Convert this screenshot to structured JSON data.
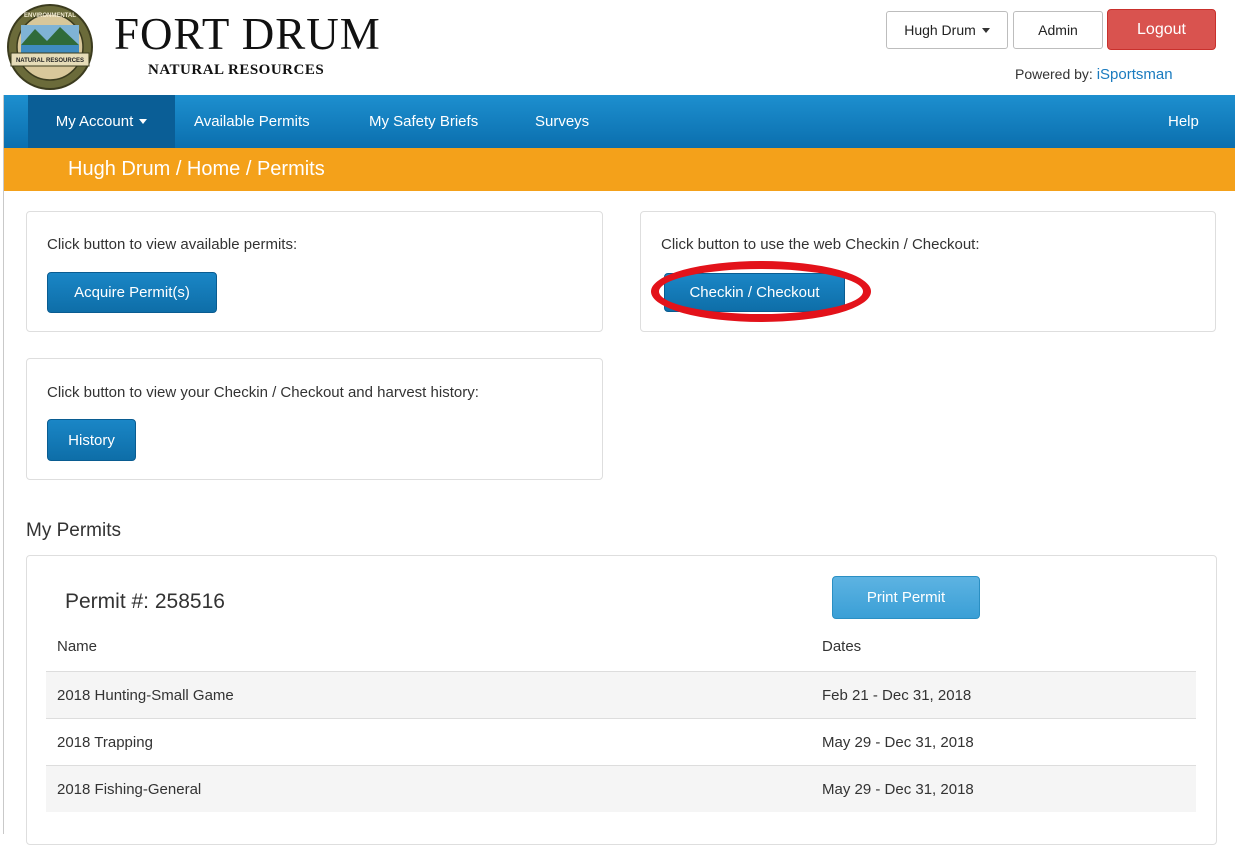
{
  "header": {
    "logo_text": [
      "ENVIRONMENTAL",
      "NATURAL RESOURCES"
    ],
    "brand_title": "FORT DRUM",
    "brand_subtitle": "NATURAL RESOURCES",
    "user_menu_label": "Hugh Drum",
    "admin_label": "Admin",
    "logout_label": "Logout",
    "powered_by_label": "Powered by:",
    "powered_by_link": "iSportsman"
  },
  "nav": {
    "items": [
      "My Account",
      "Available Permits",
      "My Safety Briefs",
      "Surveys"
    ],
    "help_label": "Help"
  },
  "breadcrumb": "Hugh Drum / Home / Permits",
  "panels": {
    "acquire": {
      "text": "Click button to view available permits:",
      "button": "Acquire Permit(s)"
    },
    "checkin": {
      "text": "Click button to use the web Checkin / Checkout:",
      "button": "Checkin / Checkout"
    },
    "history": {
      "text": "Click button to view your Checkin / Checkout and harvest history:",
      "button": "History"
    }
  },
  "permits": {
    "section_title": "My Permits",
    "permit_number": "Permit #: 258516",
    "print_button": "Print Permit",
    "columns": [
      "Name",
      "Dates"
    ],
    "rows": [
      {
        "name": "2018 Hunting-Small Game",
        "dates": "Feb 21 - Dec 31, 2018"
      },
      {
        "name": "2018 Trapping",
        "dates": "May 29 - Dec 31, 2018"
      },
      {
        "name": "2018 Fishing-General",
        "dates": "May 29 - Dec 31, 2018"
      }
    ]
  },
  "colors": {
    "nav_blue": "#1d8fcf",
    "breadcrumb_orange": "#f4a11a",
    "logout_red": "#d9534f",
    "annotation_red": "#e3121a"
  }
}
